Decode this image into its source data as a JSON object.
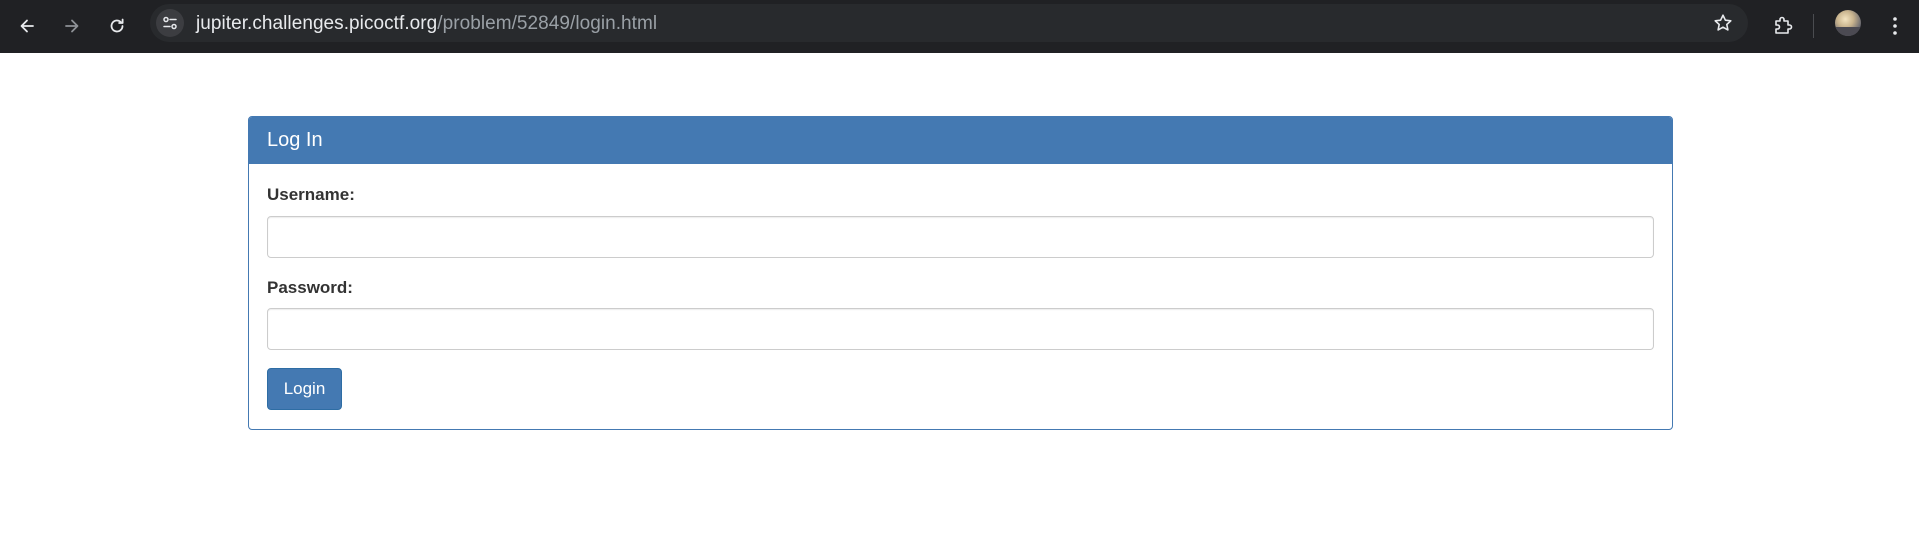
{
  "browser": {
    "url_host": "jupiter.challenges.picoctf.org",
    "url_path": "/problem/52849/login.html",
    "icons": {
      "back": "back-arrow-icon",
      "forward": "forward-arrow-icon",
      "reload": "reload-icon",
      "site_info": "tune-icon",
      "bookmark": "star-icon",
      "extensions": "puzzle-icon",
      "profile": "avatar",
      "menu": "kebab-menu-icon"
    },
    "colors": {
      "toolbar": "#202124",
      "omnibox": "#282a2d",
      "url_host": "#e8eaed",
      "url_path": "#9aa0a6"
    }
  },
  "page": {
    "panel": {
      "title": "Log In"
    },
    "form": {
      "username_label": "Username:",
      "username_value": "",
      "password_label": "Password:",
      "password_value": "",
      "submit_label": "Login"
    },
    "colors": {
      "primary": "#4479b2",
      "label_text": "#333333",
      "input_border": "#cccccc"
    }
  }
}
